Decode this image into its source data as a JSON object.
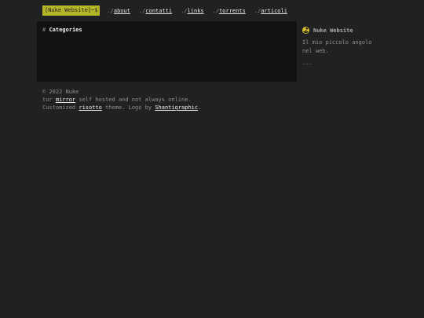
{
  "header": {
    "brand": "[Nuke Website]~$",
    "nav": [
      {
        "prefix": "./",
        "label": "about"
      },
      {
        "prefix": "./",
        "label": "contatti"
      },
      {
        "prefix": "./",
        "label": "links"
      },
      {
        "prefix": "./",
        "label": "torrents"
      },
      {
        "prefix": "./",
        "label": "articoli"
      }
    ]
  },
  "main": {
    "hash": "#",
    "heading": "Categories"
  },
  "sidebar": {
    "icon": "radiation-icon",
    "title": "Nuke Website",
    "desc_line1": "Il mio piccolo angolo",
    "desc_line2": "nel web.",
    "separator": "---"
  },
  "footer": {
    "copyright": "© 2022 Nuke",
    "line2_pre": "tor ",
    "line2_link": "mirror",
    "line2_post": " self hosted and not always online.",
    "line3_pre": "Customized ",
    "line3_link1": "risotto",
    "line3_mid": " theme. Logo by ",
    "line3_link2": "Shantigraphic",
    "line3_post": "."
  },
  "colors": {
    "background": "#202122",
    "accent": "#b5b52a",
    "panel": "#111111"
  }
}
